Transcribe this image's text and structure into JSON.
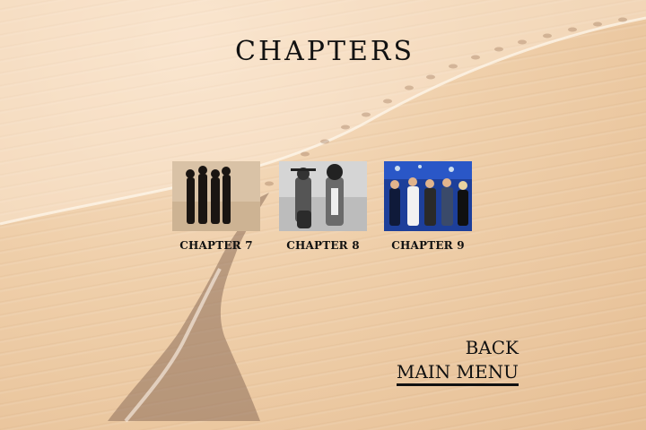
{
  "screen": {
    "title": "CHAPTERS"
  },
  "chapters": [
    {
      "label": "CHAPTER 7",
      "thumbnail_icon": "band-in-desert-photo"
    },
    {
      "label": "CHAPTER 8",
      "thumbnail_icon": "two-musicians-bw-photo"
    },
    {
      "label": "CHAPTER 9",
      "thumbnail_icon": "band-on-stage-photo"
    }
  ],
  "nav": {
    "back_label": "BACK",
    "main_menu_label": "MAIN MENU",
    "selected": "MAIN MENU"
  },
  "colors": {
    "sand_light": "#f7dfc4",
    "sand_dark": "#e6bf95",
    "text": "#111111",
    "stage_blue": "#1d3f9a"
  }
}
